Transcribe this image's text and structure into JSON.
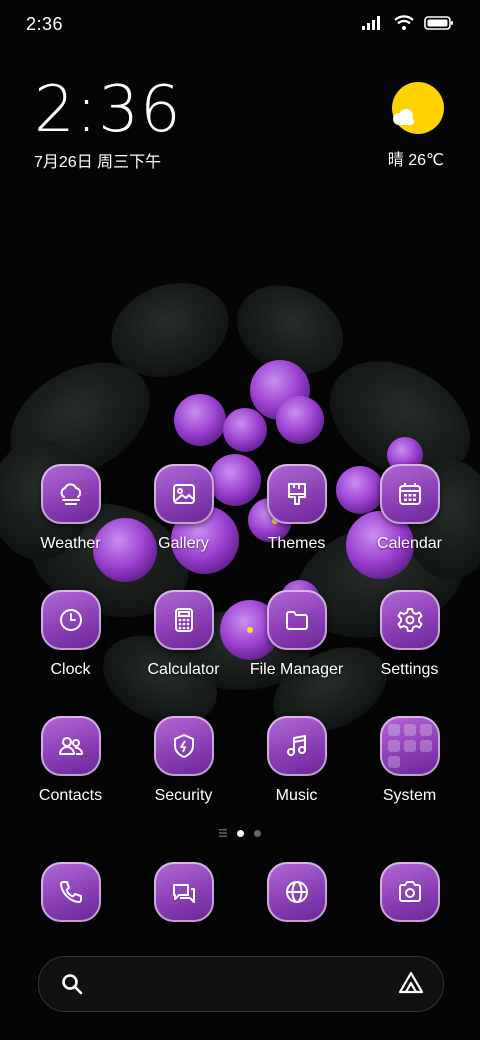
{
  "status_bar": {
    "time": "2:36"
  },
  "clock_widget": {
    "time": "2:36",
    "date": "7月26日 周三下午"
  },
  "weather_widget": {
    "text": "晴 26℃",
    "icon": "sun-cloud-icon"
  },
  "apps": [
    {
      "label": "Weather",
      "icon": "cloud-icon"
    },
    {
      "label": "Gallery",
      "icon": "image-icon"
    },
    {
      "label": "Themes",
      "icon": "brush-icon"
    },
    {
      "label": "Calendar",
      "icon": "calendar-icon"
    },
    {
      "label": "Clock",
      "icon": "clock-icon"
    },
    {
      "label": "Calculator",
      "icon": "calculator-icon"
    },
    {
      "label": "File Manager",
      "icon": "folder-icon"
    },
    {
      "label": "Settings",
      "icon": "gear-icon"
    },
    {
      "label": "Contacts",
      "icon": "contacts-icon"
    },
    {
      "label": "Security",
      "icon": "shield-icon"
    },
    {
      "label": "Music",
      "icon": "music-note-icon"
    },
    {
      "label": "System",
      "icon": "folder-grid-icon"
    }
  ],
  "dock": [
    {
      "icon": "phone-icon"
    },
    {
      "icon": "messages-icon"
    },
    {
      "icon": "globe-icon"
    },
    {
      "icon": "camera-icon"
    }
  ],
  "page_indicator": {
    "pages": 2,
    "active": 1
  },
  "colors": {
    "tile_accent": "#9b4fc6",
    "sun": "#ffd200",
    "background": "#050505"
  }
}
